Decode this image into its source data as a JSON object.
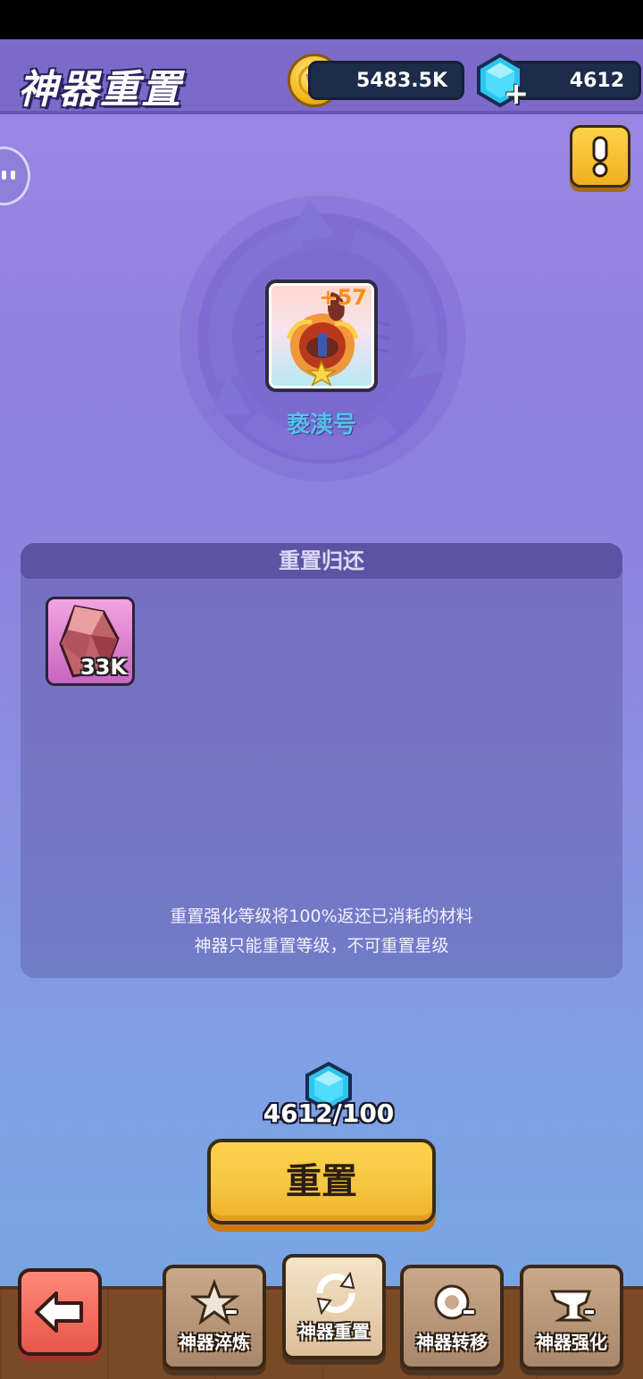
{
  "header": {
    "title": "神器重置",
    "coins": "5483.5K",
    "gems": "4612"
  },
  "artifact": {
    "level": "+57",
    "name": "亵渎号"
  },
  "panel": {
    "title": "重置归还",
    "reward_count": "33K",
    "note_line1": "重置强化等级将100%返还已消耗的材料",
    "note_line2": "神器只能重置等级，不可重置星级"
  },
  "cost": {
    "text": "4612/100"
  },
  "reset_button": {
    "label": "重置"
  },
  "tabs": [
    {
      "label": "神器淬炼",
      "icon": "star-hammer-icon"
    },
    {
      "label": "神器重置",
      "icon": "reset-arrows-icon"
    },
    {
      "label": "神器转移",
      "icon": "transfer-icon"
    },
    {
      "label": "神器强化",
      "icon": "anvil-icon"
    }
  ],
  "colors": {
    "accent_yellow": "#f5c640",
    "name_blue": "#56c2e8",
    "level_orange": "#ff8a26",
    "back_red": "#e8564a"
  }
}
